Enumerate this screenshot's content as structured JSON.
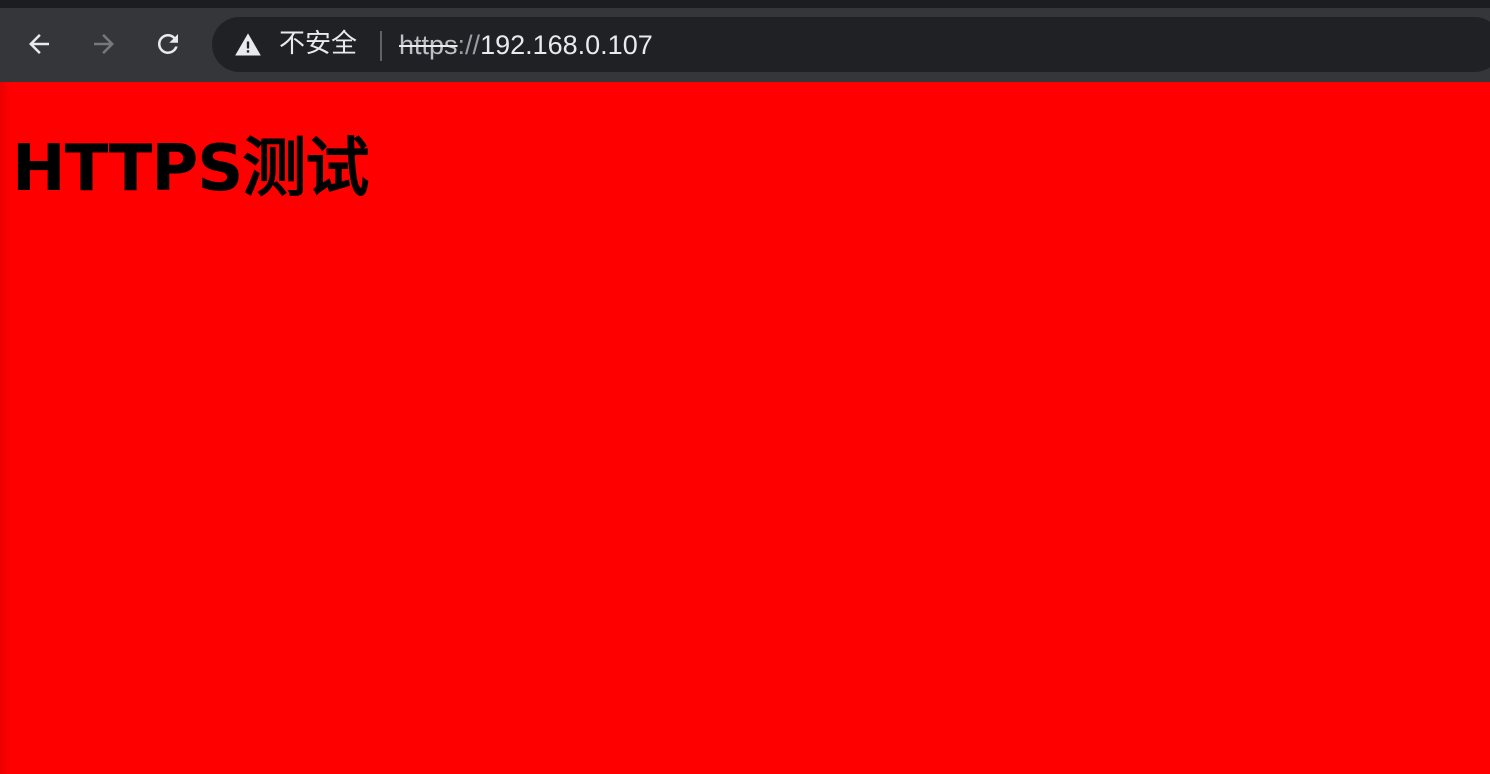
{
  "browser": {
    "security_label": "不安全",
    "url": {
      "scheme": "https",
      "separator": "://",
      "host": "192.168.0.107"
    },
    "icons": {
      "back": "arrow-left-icon",
      "forward": "arrow-right-icon",
      "reload": "reload-icon",
      "security": "warning-triangle-icon"
    },
    "colors": {
      "toolbar": "#35363a",
      "omnibox": "#202124"
    }
  },
  "page": {
    "heading": "HTTPS测试",
    "background_color": "#ff0000"
  }
}
